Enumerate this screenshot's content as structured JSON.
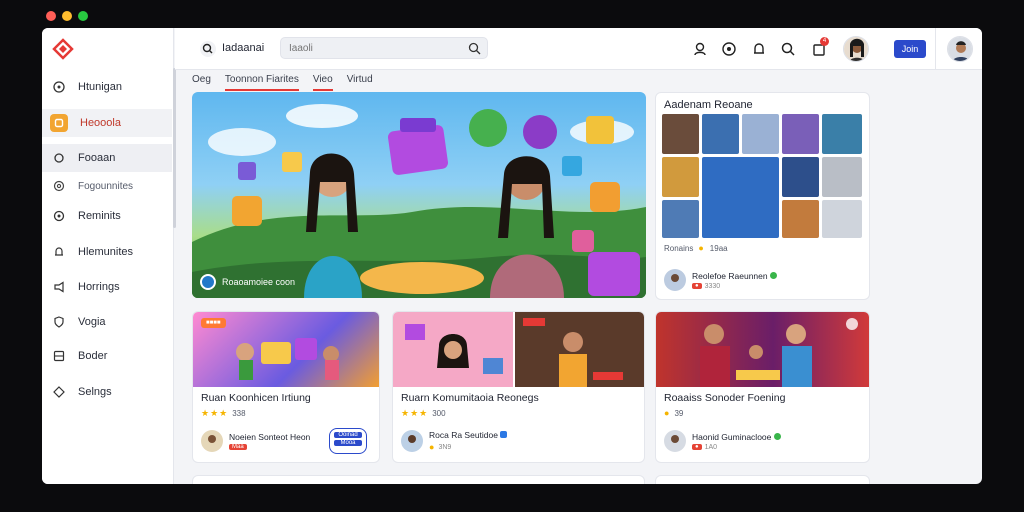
{
  "colors": {
    "accent_red": "#e53935",
    "brand_blue": "#2b4acb",
    "star_gold": "#f5b400",
    "sidebar_active_icon": "#f2a531"
  },
  "sidebar": {
    "logo": "diamond-logo-icon",
    "items": [
      {
        "label": "Htunigan",
        "icon": "help-circle-icon"
      },
      {
        "label": "Heooola",
        "icon": "home-icon"
      },
      {
        "label": "Fooaan",
        "icon": "circle-icon"
      },
      {
        "label": "Fogounnites",
        "icon": "at-icon"
      },
      {
        "label": "Reminits",
        "icon": "settings-gear-icon"
      },
      {
        "label": "Hlemunites",
        "icon": "bell-icon"
      },
      {
        "label": "Horrings",
        "icon": "megaphone-icon"
      },
      {
        "label": "Vogia",
        "icon": "shield-icon"
      },
      {
        "label": "Boder",
        "icon": "grid-icon"
      },
      {
        "label": "Selngs",
        "icon": "settings-diamond-icon"
      }
    ]
  },
  "header": {
    "title": "Iadaanai",
    "search_placeholder": "Iaaoli",
    "join_label": "Join",
    "notification_count": "4",
    "icons": [
      "user-icon",
      "globe-icon",
      "bell-icon",
      "search-icon",
      "bag-icon"
    ]
  },
  "tabs": [
    {
      "label": "Oeg",
      "active": false
    },
    {
      "label": "Toonnon Fiarites",
      "active": true
    },
    {
      "label": "Vieo",
      "active": true
    },
    {
      "label": "Virtud",
      "active": false
    }
  ],
  "hero": {
    "caption": "Roaoamoiee coon"
  },
  "panel": {
    "title": "Aadenam Reoane",
    "meta_text": "Ronains",
    "meta_count": "19aa",
    "author_name": "Reolefoe Raeunnen",
    "author_sub": "3330"
  },
  "cards": [
    {
      "tag": "",
      "title": "Ruan Koonhicen Irtiung",
      "stars": "★★★",
      "meta": "338",
      "author_name": "Noeien Sonteot Heon",
      "author_sub": "Maa",
      "play_label_top": "Ooinad",
      "play_label_bottom": "Mooa"
    },
    {
      "tag": "",
      "title": "Ruarn Komumitaoia Reonegs",
      "stars": "★★★",
      "meta": "300",
      "author_name": "Roca Ra Seutidoe",
      "author_sub": "3N9"
    },
    {
      "tag": "",
      "title": "Roaaiss Sonoder Foening",
      "stars": "",
      "meta": "39",
      "author_name": "Haonid Guminaclooe",
      "author_sub": "1A0"
    }
  ]
}
